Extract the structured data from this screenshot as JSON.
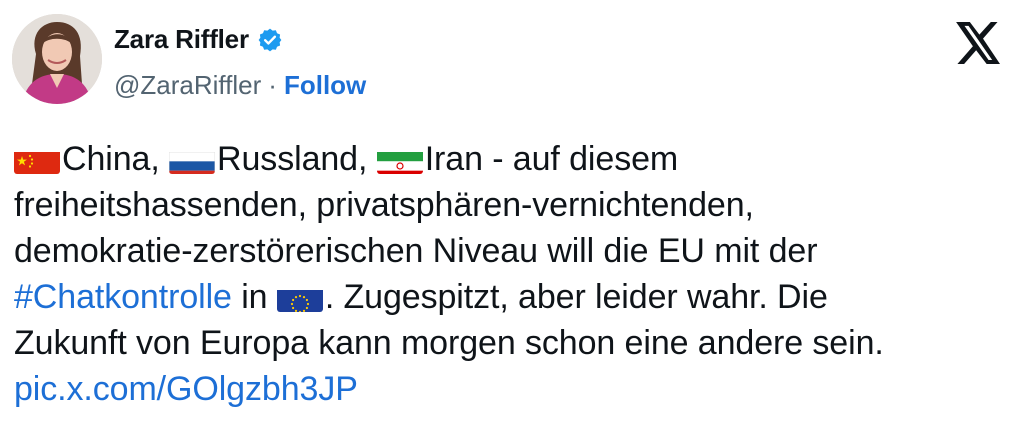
{
  "author": {
    "display_name": "Zara Riffler",
    "handle": "@ZaraRiffler",
    "separator": "·",
    "follow_label": "Follow",
    "verified_color": "#1d9bf0"
  },
  "tweet": {
    "country1": "China,",
    "country2": "Russland,",
    "country3": "Iran - auf diesem",
    "line2": "freiheitshassenden, privatsphären-vernichtenden,",
    "line3": "demokratie-zerstörerischen Niveau will die EU mit der",
    "hashtag": "#Chatkontrolle",
    "line4_mid": " in ",
    "line4_end": ". Zugespitzt, aber leider wahr. Die",
    "line5": "Zukunft von Europa kann morgen schon eine andere sein.",
    "media_link": "pic.x.com/GOlgzbh3JP"
  },
  "colors": {
    "link": "#1d6fd6",
    "muted": "#536471",
    "text": "#0f1419"
  },
  "icons": [
    "verified-badge-icon",
    "x-logo-icon",
    "china-flag-icon",
    "russia-flag-icon",
    "iran-flag-icon",
    "eu-flag-icon"
  ]
}
